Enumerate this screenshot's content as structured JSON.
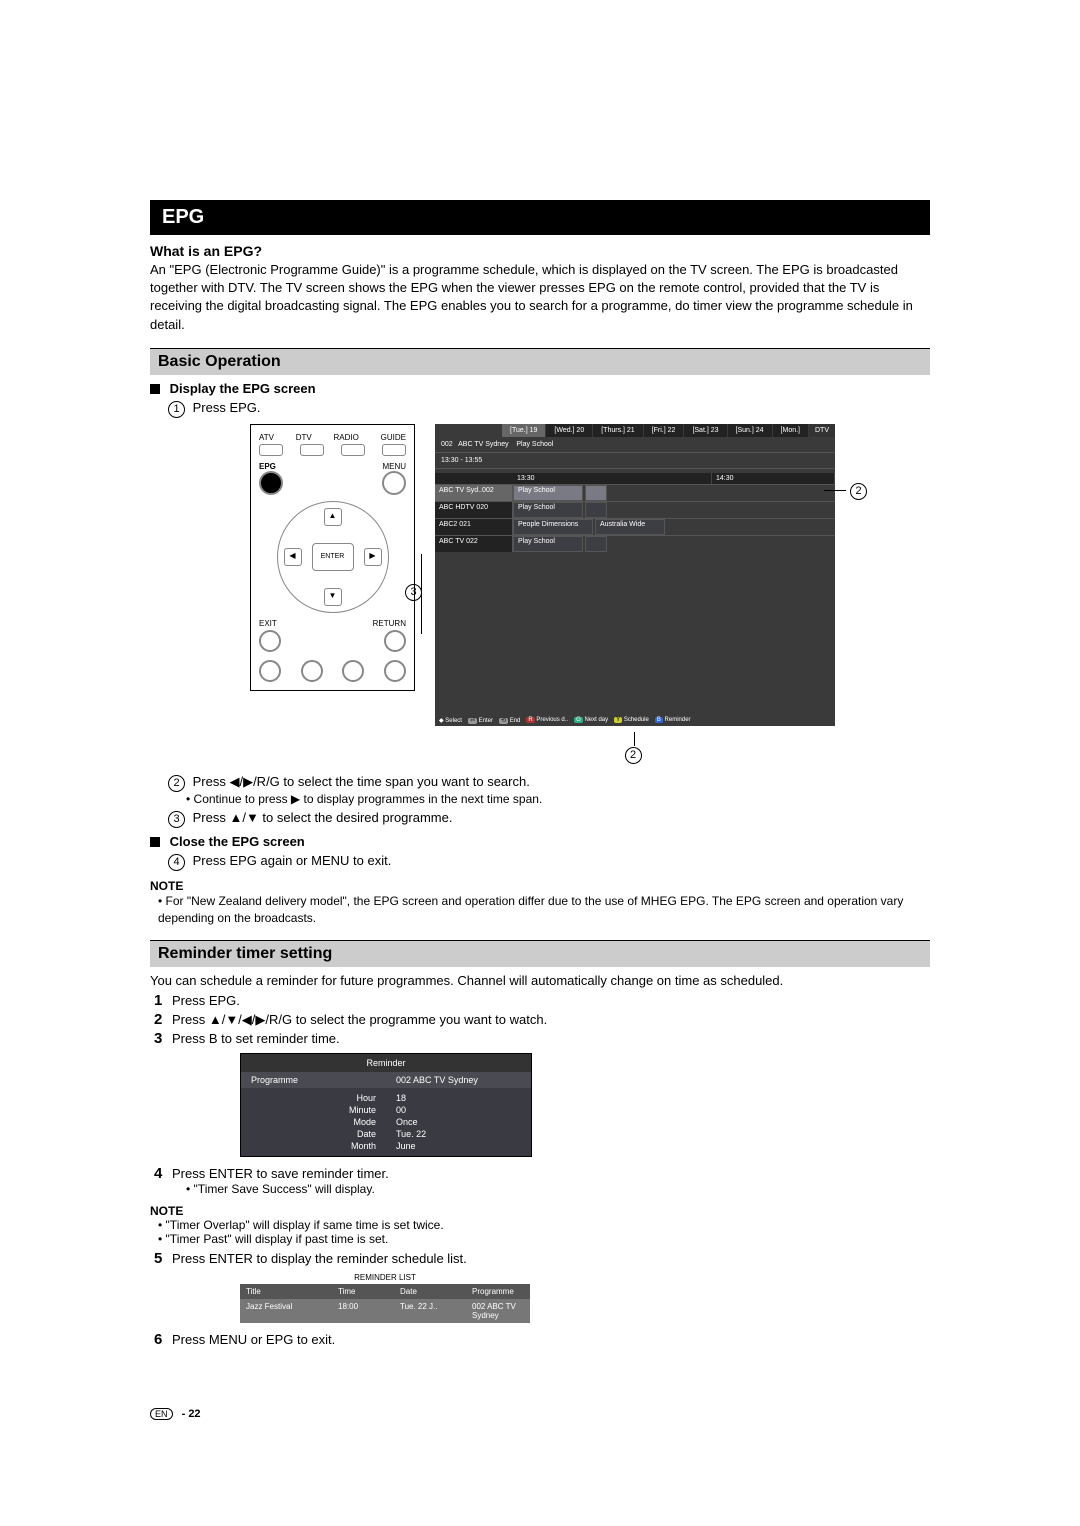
{
  "title": "EPG",
  "whatis_head": "What is an EPG?",
  "whatis_text": "An \"EPG (Electronic Programme Guide)\" is a programme schedule, which is displayed on the TV screen. The EPG is broadcasted together with DTV. The TV screen shows the EPG when the viewer presses EPG on the remote control, provided that the TV is receiving the digital broadcasting signal. The EPG enables you to search for a programme, do timer view the programme schedule in detail.",
  "basic_op": "Basic Operation",
  "display_epg": "Display the EPG screen",
  "step1": "Press EPG.",
  "remote": {
    "atv": "ATV",
    "dtv": "DTV",
    "radio": "RADIO",
    "guide": "GUIDE",
    "epg": "EPG",
    "menu": "MENU",
    "enter": "ENTER",
    "exit": "EXIT",
    "return": "RETURN"
  },
  "epg": {
    "days": [
      "[Tue.] 19",
      "[Wed.] 20",
      "[Thurs.] 21",
      "[Fri.] 22",
      "[Sat.] 23",
      "[Sun.] 24",
      "[Mon.]"
    ],
    "dtv": "DTV",
    "ch": "002",
    "chname": "ABC TV Sydney",
    "playsch": "Play School",
    "timespan": "13:30  -  13:55",
    "times": [
      "13:30",
      "14:30"
    ],
    "rows": [
      {
        "ch": "ABC TV Syd..002",
        "lit": true,
        "progs": [
          "Play School"
        ]
      },
      {
        "ch": "ABC HDTV   020",
        "progs": [
          "Play School"
        ]
      },
      {
        "ch": "ABC2       021",
        "progs": [
          "People Dimensions",
          "Australia Wide"
        ]
      },
      {
        "ch": "ABC TV     022",
        "progs": [
          "Play School"
        ]
      }
    ],
    "footer": {
      "select": "Select",
      "enter": "Enter",
      "end": "End",
      "r": "Previous d..",
      "g": "Next day",
      "y": "Schedule",
      "b": "Reminder"
    }
  },
  "step2": "Press ◀/▶/R/G to select the time span you want to search.",
  "step2b": "Continue to press ▶ to display programmes in the next time span.",
  "step3": "Press ▲/▼ to select the desired programme.",
  "close_epg": "Close the EPG screen",
  "step4": "Press EPG again or MENU to exit.",
  "note1_h": "NOTE",
  "note1": "For \"New Zealand delivery model\", the EPG screen and operation differ due to the use of MHEG EPG. The EPG screen and operation vary depending on the broadcasts.",
  "reminder_sec": "Reminder timer setting",
  "reminder_intro": "You can schedule a reminder for future programmes. Channel will automatically change on time as scheduled.",
  "r1": "Press EPG.",
  "r2": "Press ▲/▼/◀/▶/R/G to select the programme you want to watch.",
  "r3": "Press B to set reminder time.",
  "reminder": {
    "title": "Reminder",
    "programme": "Programme",
    "progval": "002 ABC TV Sydney",
    "labels": [
      "Hour",
      "Minute",
      "Mode",
      "Date",
      "Month"
    ],
    "values": [
      "18",
      "00",
      "Once",
      "Tue. 22",
      "June"
    ]
  },
  "r4": "Press ENTER to save reminder timer.",
  "r4b": "\"Timer Save Success\" will display.",
  "note2_h": "NOTE",
  "note2a": "\"Timer Overlap\" will display if same time is set twice.",
  "note2b": "\"Timer Past\" will display if past time is set.",
  "r5": "Press ENTER to display the reminder schedule list.",
  "rlist": {
    "title": "REMINDER LIST",
    "hdr": [
      "Title",
      "Time",
      "Date",
      "Programme"
    ],
    "row": [
      "Jazz Festival",
      "18:00",
      "Tue. 22 J..",
      "002 ABC TV Sydney"
    ]
  },
  "r6": "Press MENU or EPG to exit.",
  "page_foot_en": "EN",
  "page_foot_num": "22"
}
